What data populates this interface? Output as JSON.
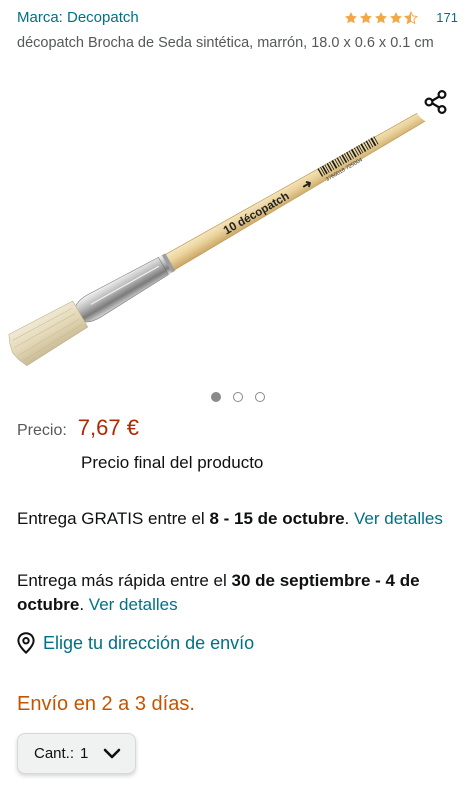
{
  "brand": {
    "link": "Marca: Decopatch"
  },
  "rating": {
    "count": "171",
    "stars": 4.5,
    "star_color": "#f3a847"
  },
  "product": {
    "title": "décopatch Brocha de Seda sintética, marrón, 18.0 x 0.6 x 0.1 cm"
  },
  "image": {
    "brand_print": "décopatch",
    "size_print": "10",
    "barcode_digits": "3760018 725004",
    "share_icon": "share-icon",
    "carousel": {
      "count": 3,
      "active": 0
    }
  },
  "price": {
    "label": "Precio:",
    "value": "7,67 €",
    "note": "Precio final del producto",
    "color": "#b12704"
  },
  "delivery": {
    "free": {
      "prefix": "Entrega GRATIS entre el ",
      "dates": "8 - 15 de octubre",
      "suffix": ". ",
      "link": "Ver detalles"
    },
    "fast": {
      "prefix": "Entrega más rápida entre el ",
      "dates": "30 de septiembre - 4 de octubre",
      "suffix": ". ",
      "link": "Ver detalles"
    }
  },
  "address": {
    "link": "Elige tu dirección de envío",
    "icon": "location-pin-icon"
  },
  "shipping": {
    "text": "Envío en 2 a 3 días.",
    "color": "#c45500"
  },
  "quantity": {
    "label": "Cant.:",
    "value": "1"
  },
  "colors": {
    "link": "#007185",
    "text": "#0f1111",
    "secondary": "#565959"
  }
}
